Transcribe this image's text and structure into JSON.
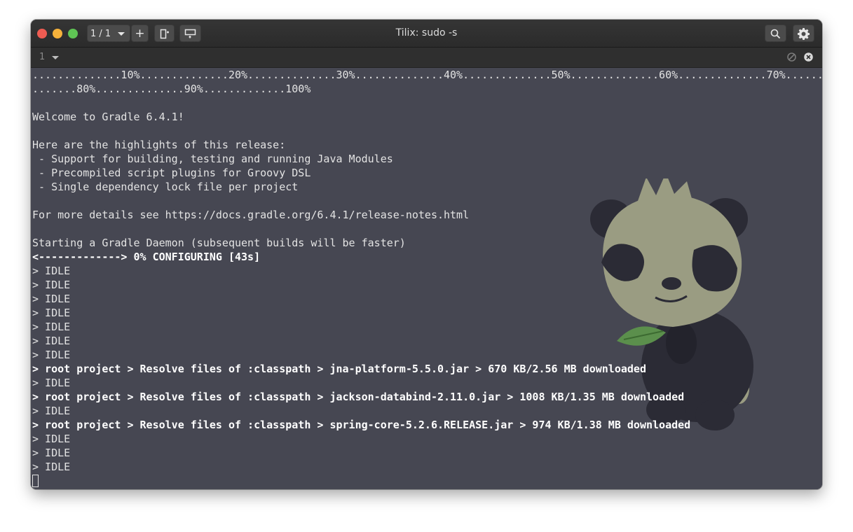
{
  "window": {
    "title": "Tilix: sudo -s",
    "session_label": "1 / 1",
    "add_label": "+"
  },
  "tab": {
    "number": "1"
  },
  "colors": {
    "terminal_bg": "#464752",
    "text": "#e3e3e3",
    "close": "#ee5c52",
    "minimize": "#f6b23b",
    "maximize": "#5fc454",
    "panda_face": "#9a9c82",
    "panda_dark": "#2b2b35",
    "leaf": "#5b8f4c"
  },
  "icons": [
    "chevron-down-icon",
    "add-tab-icon",
    "split-right-icon",
    "split-down-icon",
    "search-icon",
    "gear-icon",
    "sync-icon",
    "close-icon"
  ],
  "terminal": {
    "lines": [
      {
        "text": "..............10%..............20%..............30%..............40%..............50%..............60%..............70%......",
        "bold": false
      },
      {
        "text": ".......80%..............90%.............100%",
        "bold": false
      },
      {
        "text": "",
        "bold": false
      },
      {
        "text": "Welcome to Gradle 6.4.1!",
        "bold": false
      },
      {
        "text": "",
        "bold": false
      },
      {
        "text": "Here are the highlights of this release:",
        "bold": false
      },
      {
        "text": " - Support for building, testing and running Java Modules",
        "bold": false
      },
      {
        "text": " - Precompiled script plugins for Groovy DSL",
        "bold": false
      },
      {
        "text": " - Single dependency lock file per project",
        "bold": false
      },
      {
        "text": "",
        "bold": false
      },
      {
        "text": "For more details see https://docs.gradle.org/6.4.1/release-notes.html",
        "bold": false
      },
      {
        "text": "",
        "bold": false
      },
      {
        "text": "Starting a Gradle Daemon (subsequent builds will be faster)",
        "bold": false
      },
      {
        "text": "<-------------> 0% CONFIGURING [43s]",
        "bold": true
      },
      {
        "text": "> IDLE",
        "bold": false
      },
      {
        "text": "> IDLE",
        "bold": false
      },
      {
        "text": "> IDLE",
        "bold": false
      },
      {
        "text": "> IDLE",
        "bold": false
      },
      {
        "text": "> IDLE",
        "bold": false
      },
      {
        "text": "> IDLE",
        "bold": false
      },
      {
        "text": "> IDLE",
        "bold": false
      },
      {
        "text": "> root project > Resolve files of :classpath > jna-platform-5.5.0.jar > 670 KB/2.56 MB downloaded",
        "bold": true
      },
      {
        "text": "> IDLE",
        "bold": false
      },
      {
        "text": "> root project > Resolve files of :classpath > jackson-databind-2.11.0.jar > 1008 KB/1.35 MB downloaded",
        "bold": true
      },
      {
        "text": "> IDLE",
        "bold": false
      },
      {
        "text": "> root project > Resolve files of :classpath > spring-core-5.2.6.RELEASE.jar > 974 KB/1.38 MB downloaded",
        "bold": true
      },
      {
        "text": "> IDLE",
        "bold": false
      },
      {
        "text": "> IDLE",
        "bold": false
      },
      {
        "text": "> IDLE",
        "bold": false
      }
    ]
  }
}
